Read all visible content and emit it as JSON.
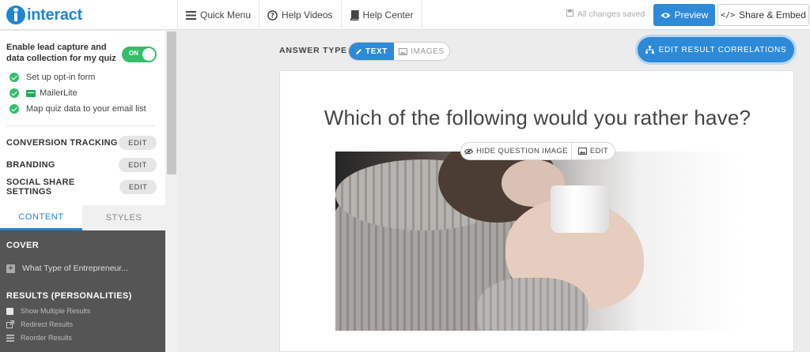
{
  "app": {
    "logo_text": "interact"
  },
  "topnav": [
    {
      "icon": "hamburger-icon",
      "label": "Quick Menu"
    },
    {
      "icon": "help-circle-icon",
      "label": "Help Videos"
    },
    {
      "icon": "book-icon",
      "label": "Help Center"
    }
  ],
  "header": {
    "saved_status": "All changes saved",
    "preview_label": "Preview",
    "share_label": "Share & Embed",
    "share_icon_glyph": "</>"
  },
  "sidebar": {
    "lead_capture_label": "Enable lead capture and data collection for my quiz",
    "toggle_label": "ON",
    "toggle_on": true,
    "checklist": [
      {
        "label": "Set up opt-in form"
      },
      {
        "label": "MailerLite"
      },
      {
        "label": "Map quiz data to your email list"
      }
    ],
    "settings": [
      {
        "label": "CONVERSION TRACKING",
        "button": "EDIT"
      },
      {
        "label": "BRANDING",
        "button": "EDIT"
      },
      {
        "label": "SOCIAL SHARE SETTINGS",
        "button": "EDIT"
      }
    ],
    "tabs": {
      "content": "CONTENT",
      "styles": "STYLES",
      "active": "content"
    },
    "outline": {
      "cover_heading": "COVER",
      "cover_item": "What Type of Entrepreneur...",
      "cover_item_prefix": "+",
      "results_heading": "RESULTS (PERSONALITIES)",
      "results_options": [
        {
          "icon": "checkbox-icon",
          "label": "Show Multiple Results"
        },
        {
          "icon": "external-link-icon",
          "label": "Redirect Results"
        },
        {
          "icon": "list-icon",
          "label": "Reorder Results"
        }
      ]
    }
  },
  "editor": {
    "answer_type_label": "ANSWER TYPE",
    "answer_type_options": {
      "text": "TEXT",
      "images": "IMAGES",
      "selected": "text"
    },
    "result_correlations_label": "EDIT RESULT CORRELATIONS",
    "question_text": "Which of the following would you rather have?",
    "image_tools": {
      "hide_label": "HIDE QUESTION IMAGE",
      "edit_label": "EDIT"
    }
  },
  "colors": {
    "brand": "#1f86cf",
    "primary_button": "#2d8ad8",
    "success": "#33bd6c",
    "sidebar_dark": "#555555"
  }
}
